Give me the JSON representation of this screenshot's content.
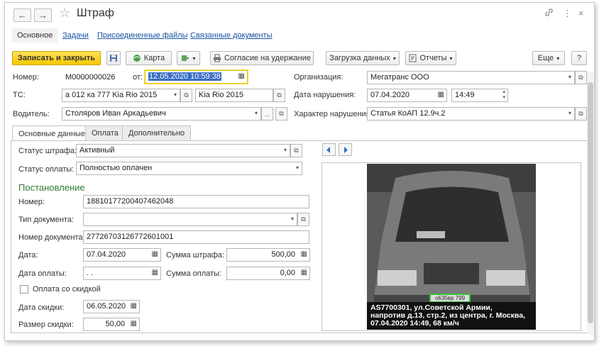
{
  "window": {
    "title": "Штраф",
    "back_icon": "←",
    "forward_icon": "→",
    "favorite_icon": "☆",
    "link_icon": "🔗",
    "menu_icon": "⋮",
    "close_icon": "×"
  },
  "subtabs": [
    "Основное",
    "Задачи",
    "Присоединенные файлы",
    "Связанные документы"
  ],
  "toolbar": {
    "save_close": "Записать и закрыть",
    "map": "Карта",
    "consent": "Согласие на удержание",
    "load_data": "Загрузка данных",
    "reports": "Отчеты",
    "more": "Еще",
    "help": "?"
  },
  "header": {
    "number_label": "Номер:",
    "number_value": "М0000000026",
    "from_label": "от:",
    "from_value": "12.05.2020 10:59:38",
    "ts_label": "ТС:",
    "ts_value": "а 012 ка 777 Kia Rio 2015",
    "ts_model": "Kia Rio 2015",
    "driver_label": "Водитель:",
    "driver_value": "Столяров Иван Аркадьевич",
    "driver_more": "...",
    "org_label": "Организация:",
    "org_value": "Мегатранс ООО",
    "violation_date_label": "Дата нарушения:",
    "violation_date": "07.04.2020",
    "violation_time": "14:49",
    "nature_label": "Характер нарушения:",
    "nature_value": "Статья КоАП 12.9ч.2"
  },
  "tabs": [
    "Основные данные",
    "Оплата",
    "Дополнительно"
  ],
  "main": {
    "fine_status_label": "Статус штрафа:",
    "fine_status": "Активный",
    "pay_status_label": "Статус оплаты:",
    "pay_status": "Полностью оплачен",
    "section_title": "Постановление",
    "number_label": "Номер:",
    "number_value": "18810177200407462048",
    "doc_type_label": "Тип документа:",
    "doc_type_value": "",
    "doc_number_label": "Номер документа:",
    "doc_number_value": "27726703126772601001",
    "date_label": "Дата:",
    "date_value": "07.04.2020",
    "fine_sum_label": "Сумма штрафа:",
    "fine_sum_value": "500,00",
    "pay_date_label": "Дата оплаты:",
    "pay_date_value": " .  .",
    "pay_sum_label": "Сумма оплаты:",
    "pay_sum_value": "0,00",
    "discount_check_label": "Оплата со скидкой",
    "discount_date_label": "Дата скидки:",
    "discount_date_value": "06.05.2020",
    "discount_size_label": "Размер скидки:",
    "discount_size_value": "50,00"
  },
  "photo": {
    "plate": "о635вр 799",
    "caption_line1": "AS7700301, ул.Советской Армии,",
    "caption_line2": "напротив д.13, стр.2, из центра, г. Москва,",
    "caption_line3": "07.04.2020 14:49, 68 км/ч"
  },
  "colors": {
    "accent_yellow": "#f5c800",
    "link_blue": "#1a52a0",
    "section_green": "#2e7d32",
    "selection_blue": "#3a6ec6"
  }
}
